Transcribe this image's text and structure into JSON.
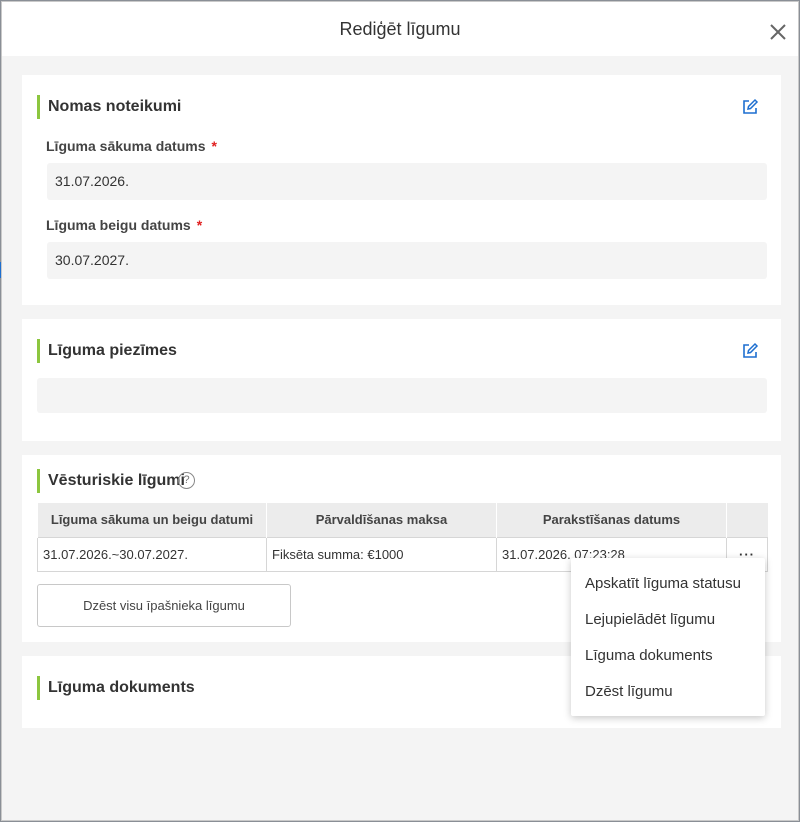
{
  "modal": {
    "title": "Rediģēt līgumu"
  },
  "rental_terms": {
    "title": "Nomas noteikumi",
    "start_label": "Līguma sākuma datums",
    "start_value": "31.07.2026.",
    "end_label": "Līguma beigu datums",
    "end_value": "30.07.2027.",
    "required_mark": "*"
  },
  "notes": {
    "title": "Līguma piezīmes",
    "value": ""
  },
  "history": {
    "title": "Vēsturiskie līgumi",
    "help": "?",
    "columns": [
      "Līguma sākuma un beigu datumi",
      "Pārvaldīšanas maksa",
      "Parakstīšanas datums"
    ],
    "rows": [
      {
        "period": "31.07.2026.~30.07.2027.",
        "fee": "Fiksēta summa: €1000",
        "signed": "31.07.2026. 07:23:28",
        "more": "···"
      }
    ],
    "delete_all_label": "Dzēst visu īpašnieka līgumu"
  },
  "document": {
    "title": "Līguma dokuments"
  },
  "context_menu": {
    "items": [
      "Apskatīt līguma statusu",
      "Lejupielādēt līgumu",
      "Līguma dokuments",
      "Dzēst līgumu"
    ]
  },
  "colors": {
    "accent_bar": "#8cc63f",
    "edit_icon": "#1e6fd0",
    "required": "#e02020"
  }
}
